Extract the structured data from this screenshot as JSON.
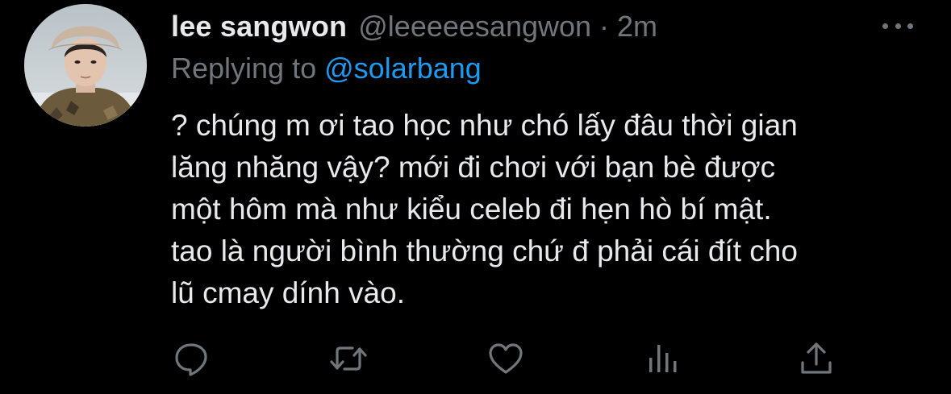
{
  "tweet": {
    "display_name": "lee sangwon",
    "handle": "@leeeeesangwon",
    "separator": "·",
    "time": "2m",
    "replying_prefix": "Replying to",
    "replying_to": "@solarbang",
    "text": "? chúng m ơi tao học như chó lấy đâu thời gian\nlăng nhăng vậy? mới đi chơi với bạn bè được\nmột hôm mà như kiểu celeb đi hẹn hò bí mật.\ntao là người bình thường chứ đ phải cái đít cho\nlũ cmay dính vào."
  },
  "icons": {
    "more": "more-horizontal-icon",
    "reply": "reply-icon",
    "retweet": "retweet-icon",
    "like": "heart-icon",
    "analytics": "analytics-icon",
    "share": "share-icon"
  },
  "colors": {
    "background": "#000000",
    "primary_text": "#e7e9ea",
    "secondary_text": "#71767b",
    "accent": "#1d9bf0"
  }
}
